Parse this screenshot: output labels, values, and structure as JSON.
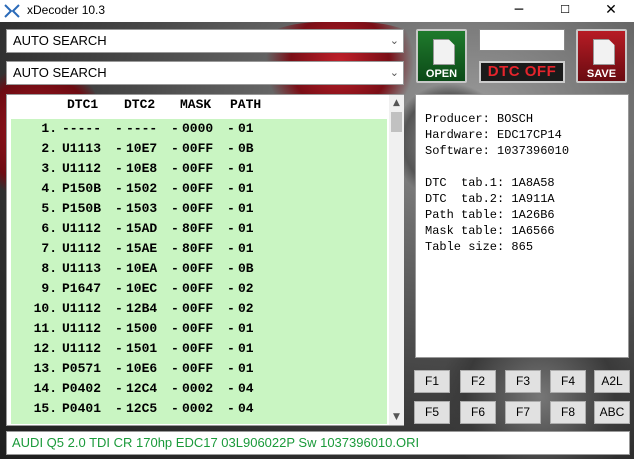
{
  "window": {
    "title": "xDecoder 10.3",
    "minimize": "─",
    "maximize": "☐",
    "close": "✕"
  },
  "search": {
    "combo1": "AUTO SEARCH",
    "combo2": "AUTO SEARCH",
    "arrow": "⌄"
  },
  "toolbar": {
    "open_label": "OPEN",
    "dtc_off_label": "DTC OFF",
    "save_label": "SAVE",
    "top_field_value": ""
  },
  "list": {
    "headers": [
      "DTC1",
      "DTC2",
      "MASK",
      "PATH"
    ],
    "rows": [
      {
        "num": "1.",
        "dtc1": "-----",
        "dtc2": "----",
        "mask": "0000",
        "path": "01"
      },
      {
        "num": "2.",
        "dtc1": "U1113",
        "dtc2": "10E7",
        "mask": "00FF",
        "path": "0B"
      },
      {
        "num": "3.",
        "dtc1": "U1112",
        "dtc2": "10E8",
        "mask": "00FF",
        "path": "01"
      },
      {
        "num": "4.",
        "dtc1": "P150B",
        "dtc2": "1502",
        "mask": "00FF",
        "path": "01"
      },
      {
        "num": "5.",
        "dtc1": "P150B",
        "dtc2": "1503",
        "mask": "00FF",
        "path": "01"
      },
      {
        "num": "6.",
        "dtc1": "U1112",
        "dtc2": "15AD",
        "mask": "80FF",
        "path": "01"
      },
      {
        "num": "7.",
        "dtc1": "U1112",
        "dtc2": "15AE",
        "mask": "80FF",
        "path": "01"
      },
      {
        "num": "8.",
        "dtc1": "U1113",
        "dtc2": "10EA",
        "mask": "00FF",
        "path": "0B"
      },
      {
        "num": "9.",
        "dtc1": "P1647",
        "dtc2": "10EC",
        "mask": "00FF",
        "path": "02"
      },
      {
        "num": "10.",
        "dtc1": "U1112",
        "dtc2": "12B4",
        "mask": "00FF",
        "path": "02"
      },
      {
        "num": "11.",
        "dtc1": "U1112",
        "dtc2": "1500",
        "mask": "00FF",
        "path": "01"
      },
      {
        "num": "12.",
        "dtc1": "U1112",
        "dtc2": "1501",
        "mask": "00FF",
        "path": "01"
      },
      {
        "num": "13.",
        "dtc1": "P0571",
        "dtc2": "10E6",
        "mask": "00FF",
        "path": "01"
      },
      {
        "num": "14.",
        "dtc1": "P0402",
        "dtc2": "12C4",
        "mask": "0002",
        "path": "04"
      },
      {
        "num": "15.",
        "dtc1": "P0401",
        "dtc2": "12C5",
        "mask": "0002",
        "path": "04"
      }
    ],
    "scroll_up": "▲",
    "scroll_down": "▼"
  },
  "info": {
    "producer": "Producer: BOSCH",
    "hardware": "Hardware: EDC17CP14",
    "software": "Software: 1037396010",
    "dtc_tab1": "DTC  tab.1: 1A8A58",
    "dtc_tab2": "DTC  tab.2: 1A911A",
    "path_table": "Path table: 1A26B6",
    "mask_table": "Mask table: 1A6566",
    "table_size": "Table size: 865"
  },
  "function_buttons": {
    "row1": [
      "F1",
      "F2",
      "F3",
      "F4",
      "A2L"
    ],
    "row2": [
      "F5",
      "F6",
      "F7",
      "F8",
      "ABC"
    ]
  },
  "status": {
    "file_name": "AUDI Q5 2.0 TDI CR 170hp  EDC17 03L906022P Sw 1037396010.ORI"
  },
  "colors": {
    "list_background": "#c9f5c2",
    "status_text": "#1a9a3a",
    "dtc_off_text": "#e4242c",
    "open_button": "#1f7a2c",
    "save_button": "#b71c25"
  }
}
